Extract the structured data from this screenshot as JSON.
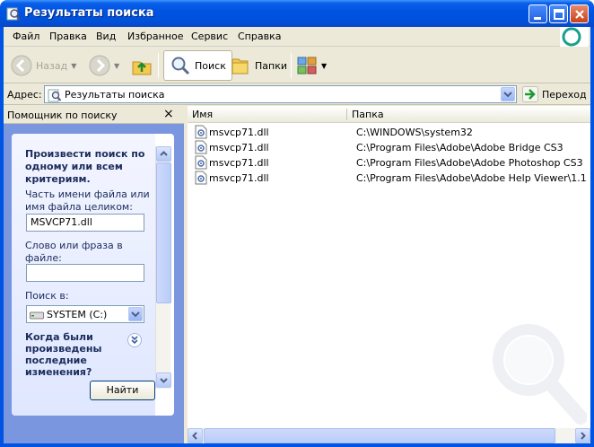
{
  "window": {
    "title": "Результаты поиска"
  },
  "menu": {
    "items": [
      "Файл",
      "Правка",
      "Вид",
      "Избранное",
      "Сервис",
      "Справка"
    ]
  },
  "toolbar": {
    "back_label": "Назад",
    "search_label": "Поиск",
    "folders_label": "Папки"
  },
  "address": {
    "label": "Адрес:",
    "value": "Результаты поиска",
    "go_label": "Переход"
  },
  "assistant": {
    "title": "Помощник по поиску",
    "close_glyph": "×",
    "heading": "Произвести поиск по одному или всем критериям.",
    "filename_label": "Часть имени файла или имя файла целиком:",
    "filename_value": "MSVCP71.dll",
    "phrase_label": "Слово или фраза в файле:",
    "phrase_value": "",
    "lookin_label": "Поиск в:",
    "lookin_value": "SYSTEM (C:)",
    "when_label": "Когда были произведены последние изменения?",
    "find_button": "Найти"
  },
  "results": {
    "columns": [
      "Имя",
      "Папка"
    ],
    "rows": [
      {
        "name": "msvcp71.dll",
        "folder": "C:\\WINDOWS\\system32"
      },
      {
        "name": "msvcp71.dll",
        "folder": "C:\\Program Files\\Adobe\\Adobe Bridge CS3"
      },
      {
        "name": "msvcp71.dll",
        "folder": "C:\\Program Files\\Adobe\\Adobe Photoshop CS3"
      },
      {
        "name": "msvcp71.dll",
        "folder": "C:\\Program Files\\Adobe\\Adobe Help Viewer\\1.1"
      }
    ]
  },
  "colors": {
    "titlebar": "#0054e3",
    "assistant_bg": "#7a96df",
    "chrome": "#ece9d8"
  }
}
